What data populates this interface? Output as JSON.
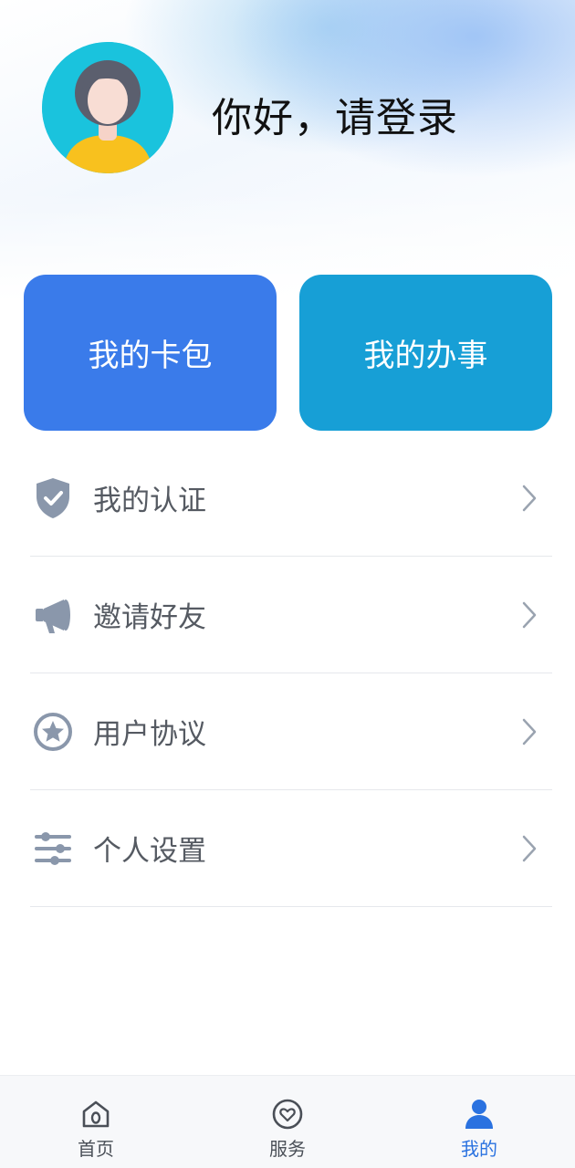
{
  "profile": {
    "greeting": "你好，请登录"
  },
  "cards": {
    "wallet_label": "我的卡包",
    "affairs_label": "我的办事"
  },
  "menu": {
    "items": [
      {
        "label": "我的认证",
        "icon": "shield-check-icon"
      },
      {
        "label": "邀请好友",
        "icon": "megaphone-icon"
      },
      {
        "label": "用户协议",
        "icon": "star-circle-icon"
      },
      {
        "label": "个人设置",
        "icon": "sliders-icon"
      }
    ]
  },
  "tabbar": {
    "tabs": [
      {
        "label": "首页",
        "icon": "home-icon",
        "active": false
      },
      {
        "label": "服务",
        "icon": "heart-circle-icon",
        "active": false
      },
      {
        "label": "我的",
        "icon": "user-icon",
        "active": true
      }
    ]
  },
  "colors": {
    "wallet_card": "#3a7bea",
    "affairs_card": "#179fd6",
    "active_tab": "#2a72e0",
    "menu_icon": "#8a97ab"
  }
}
